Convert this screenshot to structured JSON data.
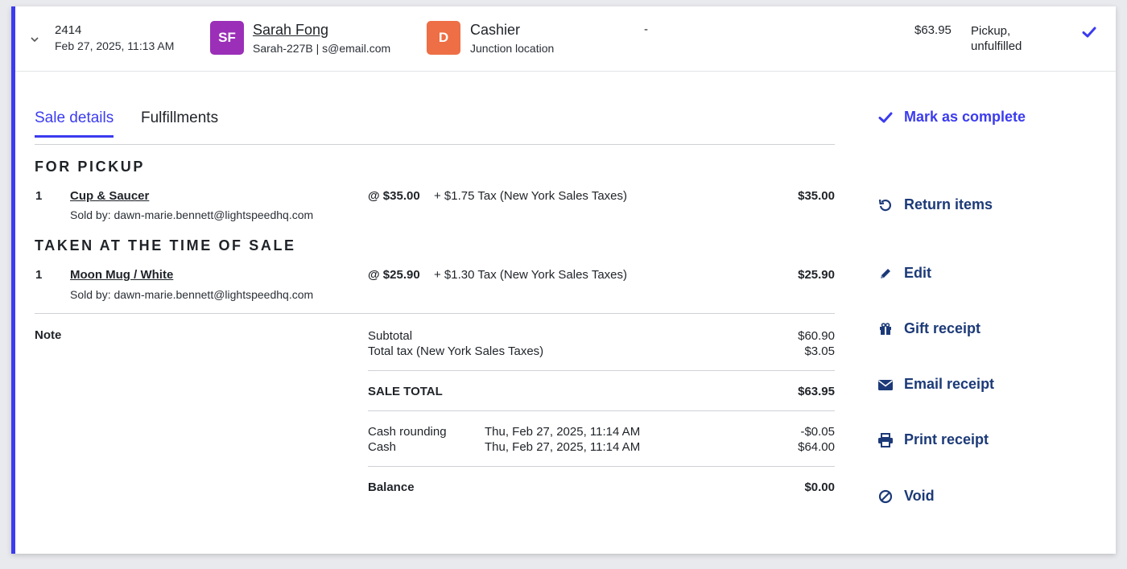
{
  "header": {
    "sale_id": "2414",
    "sale_date": "Feb 27, 2025, 11:13 AM",
    "customer_initials": "SF",
    "customer_name": "Sarah Fong",
    "customer_sub": "Sarah-227B | s@email.com",
    "cashier_initial": "D",
    "cashier_name": "Cashier",
    "cashier_location": "Junction location",
    "dash": "-",
    "total": "$63.95",
    "status": "Pickup, unfulfilled"
  },
  "tabs": [
    {
      "label": "Sale details",
      "active": true
    },
    {
      "label": "Fulfillments",
      "active": false
    }
  ],
  "sections": [
    {
      "title": "FOR PICKUP",
      "items": [
        {
          "qty": "1",
          "name": "Cup & Saucer",
          "sold_by": "Sold by: dawn-marie.bennett@lightspeedhq.com",
          "price": "@ $35.00",
          "tax": "+ $1.75 Tax (New York Sales Taxes)",
          "total": "$35.00"
        }
      ]
    },
    {
      "title": "TAKEN AT THE TIME OF SALE",
      "items": [
        {
          "qty": "1",
          "name": "Moon Mug / White",
          "sold_by": "Sold by: dawn-marie.bennett@lightspeedhq.com",
          "price": "@ $25.90",
          "tax": "+ $1.30 Tax (New York Sales Taxes)",
          "total": "$25.90"
        }
      ]
    }
  ],
  "note_label": "Note",
  "totals": {
    "subtotal_label": "Subtotal",
    "subtotal": "$60.90",
    "tax_label": "Total tax (New York Sales Taxes)",
    "tax": "$3.05",
    "sale_total_label": "SALE TOTAL",
    "sale_total": "$63.95",
    "payments": [
      {
        "label": "Cash rounding",
        "date": "Thu, Feb 27, 2025, 11:14 AM",
        "amount": "-$0.05"
      },
      {
        "label": "Cash",
        "date": "Thu, Feb 27, 2025, 11:14 AM",
        "amount": "$64.00"
      }
    ],
    "balance_label": "Balance",
    "balance": "$0.00"
  },
  "actions": {
    "mark_complete": "Mark as complete",
    "return_items": "Return items",
    "edit": "Edit",
    "gift_receipt": "Gift receipt",
    "email_receipt": "Email receipt",
    "print_receipt": "Print receipt",
    "void": "Void"
  },
  "colors": {
    "accent": "#3b3bf0",
    "action_text": "#1c3a78",
    "customer_avatar": "#9b2fb8",
    "cashier_avatar": "#ee6e45"
  }
}
